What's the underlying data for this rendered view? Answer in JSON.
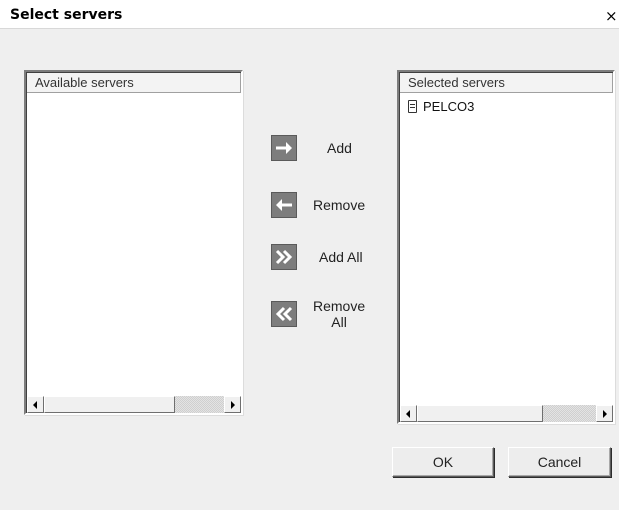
{
  "dialog": {
    "title": "Select servers",
    "close_glyph": "×"
  },
  "available": {
    "header": "Available servers",
    "items": []
  },
  "selected": {
    "header": "Selected servers",
    "items": [
      {
        "label": "PELCO3",
        "icon": "server-icon"
      }
    ]
  },
  "actions": {
    "add": {
      "label": "Add",
      "icon": "arrow-right-icon"
    },
    "remove": {
      "label": "Remove",
      "icon": "arrow-left-icon"
    },
    "add_all": {
      "label": "Add All",
      "icon": "double-chevron-right-icon"
    },
    "remove_all": {
      "label_line1": "Remove",
      "label_line2": "All",
      "icon": "double-chevron-left-icon"
    }
  },
  "buttons": {
    "ok": "OK",
    "cancel": "Cancel"
  },
  "colors": {
    "arrow_button_bg": "#7d7d7d",
    "dialog_bg": "#efefef",
    "list_bg": "#ffffff"
  }
}
